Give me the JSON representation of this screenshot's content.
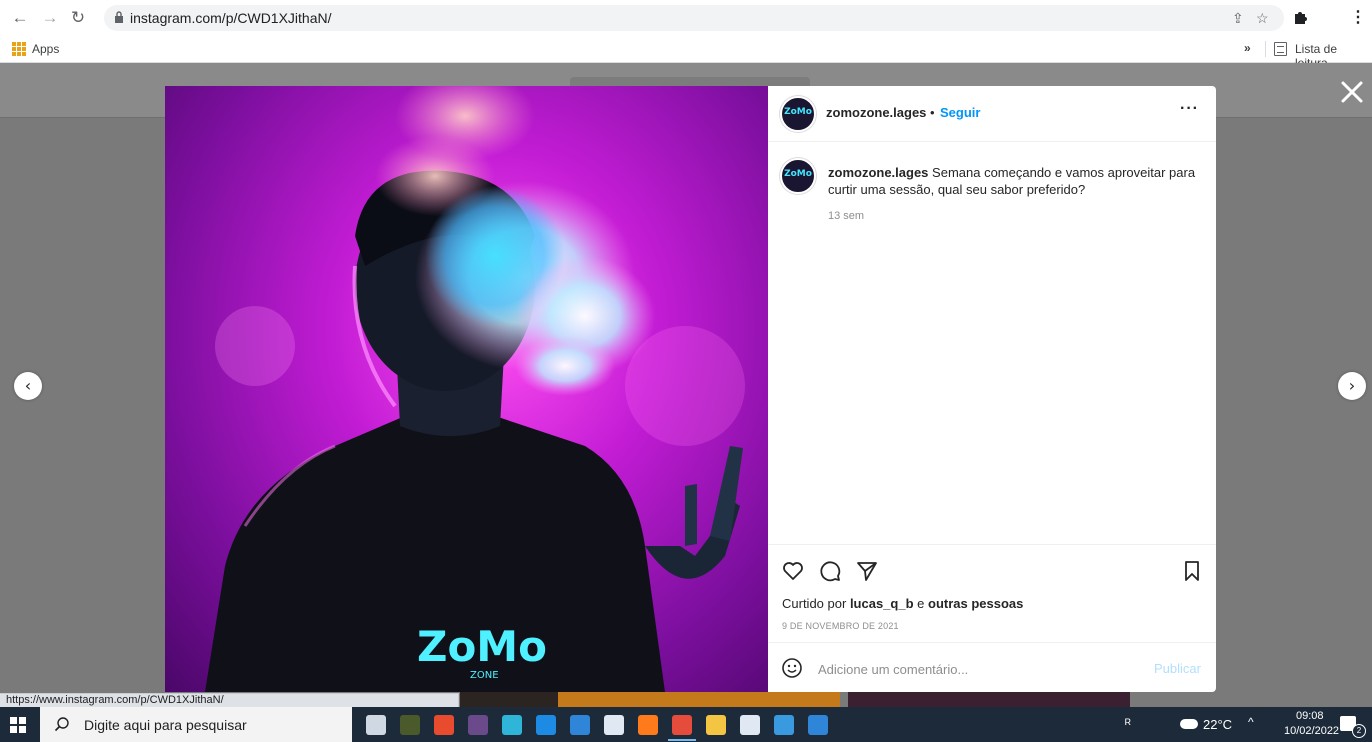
{
  "browser": {
    "url": "instagram.com/p/CWD1XJithaN/",
    "bookmarks": {
      "apps_label": "Apps",
      "more_label": "»",
      "reading_list_label": "Lista de leitura"
    },
    "status_url": "https://www.instagram.com/p/CWD1XJithaN/"
  },
  "post": {
    "header": {
      "username": "zomozone.lages",
      "separator": "•",
      "follow_label": "Seguir",
      "more_label": "···"
    },
    "avatar_text": "ZoMo",
    "caption": {
      "username": "zomozone.lages",
      "text": "Semana começando e vamos aproveitar para curtir uma sessão, qual seu sabor preferido?",
      "time": "13 sem"
    },
    "likes": {
      "prefix": "Curtido por",
      "user": "lucas_q_b",
      "connector": "e",
      "others": "outras pessoas"
    },
    "date": "9 DE NOVEMBRO DE 2021",
    "comment_placeholder": "Adicione um comentário...",
    "publish_label": "Publicar",
    "photo_logo": {
      "main": "ZoMo",
      "sub": "ZONE"
    }
  },
  "overlay": {
    "close_label": "✕",
    "prev_label": "‹",
    "next_label": "›"
  },
  "taskbar": {
    "search_placeholder": "Digite aqui para pesquisar",
    "temperature": "22°C",
    "time": "09:08",
    "date": "10/02/2022",
    "notification_count": "2",
    "apps": [
      {
        "name": "task-view-icon",
        "color": "#cfd8e3"
      },
      {
        "name": "calculator-icon",
        "color": "#4a5a2a"
      },
      {
        "name": "office-icon",
        "color": "#e94b2f"
      },
      {
        "name": "game-icon",
        "color": "#6a4a8a"
      },
      {
        "name": "edge-icon",
        "color": "#2fb5d8"
      },
      {
        "name": "mail-icon",
        "color": "#1d8ae3"
      },
      {
        "name": "store-icon",
        "color": "#2f86d8"
      },
      {
        "name": "dropbox-icon",
        "color": "#dfe8f3"
      },
      {
        "name": "firefox-icon",
        "color": "#ff7a1a"
      },
      {
        "name": "chrome-icon",
        "color": "#e54c3c"
      },
      {
        "name": "file-explorer-icon",
        "color": "#f4c542"
      },
      {
        "name": "photos-app-icon",
        "color": "#dfe8f3"
      },
      {
        "name": "image-viewer-icon",
        "color": "#3a9ae0"
      },
      {
        "name": "security-icon",
        "color": "#2f86d8"
      }
    ]
  }
}
